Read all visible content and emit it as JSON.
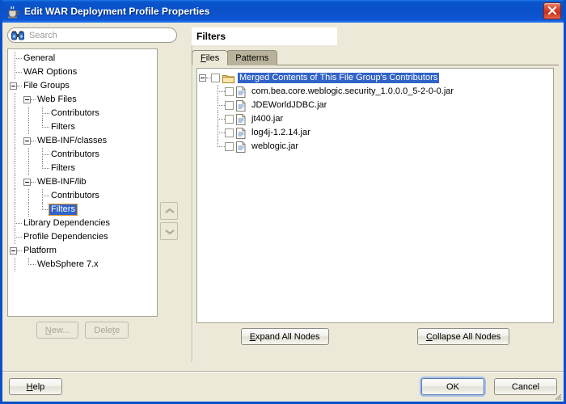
{
  "window": {
    "title": "Edit WAR Deployment Profile Properties",
    "icon": "java-coffee-cup-icon",
    "close_label": "Close",
    "frame_color": "#0a50c8"
  },
  "search": {
    "placeholder": "Search",
    "value": "",
    "icon": "binoculars-icon"
  },
  "nav_tree": {
    "nodes": [
      {
        "label": "General",
        "depth": 0,
        "toggle": "none",
        "guide": "tee",
        "selected": false
      },
      {
        "label": "WAR Options",
        "depth": 0,
        "toggle": "none",
        "guide": "tee",
        "selected": false
      },
      {
        "label": "File Groups",
        "depth": 0,
        "toggle": "expanded",
        "guide": "none",
        "selected": false
      },
      {
        "label": "Web Files",
        "depth": 1,
        "toggle": "expanded",
        "guide": "none",
        "selected": false
      },
      {
        "label": "Contributors",
        "depth": 2,
        "toggle": "none",
        "guide": "tee",
        "selected": false
      },
      {
        "label": "Filters",
        "depth": 2,
        "toggle": "none",
        "guide": "ell",
        "selected": false
      },
      {
        "label": "WEB-INF/classes",
        "depth": 1,
        "toggle": "expanded",
        "guide": "none",
        "selected": false
      },
      {
        "label": "Contributors",
        "depth": 2,
        "toggle": "none",
        "guide": "tee",
        "selected": false
      },
      {
        "label": "Filters",
        "depth": 2,
        "toggle": "none",
        "guide": "ell",
        "selected": false
      },
      {
        "label": "WEB-INF/lib",
        "depth": 1,
        "toggle": "expanded",
        "guide": "none",
        "selected": false
      },
      {
        "label": "Contributors",
        "depth": 2,
        "toggle": "none",
        "guide": "tee",
        "selected": false
      },
      {
        "label": "Filters",
        "depth": 2,
        "toggle": "none",
        "guide": "ell",
        "selected": true
      },
      {
        "label": "Library Dependencies",
        "depth": 0,
        "toggle": "none",
        "guide": "tee",
        "selected": false
      },
      {
        "label": "Profile Dependencies",
        "depth": 0,
        "toggle": "none",
        "guide": "tee",
        "selected": false
      },
      {
        "label": "Platform",
        "depth": 0,
        "toggle": "expanded",
        "guide": "none",
        "selected": false
      },
      {
        "label": "WebSphere 7.x",
        "depth": 1,
        "toggle": "none",
        "guide": "ell",
        "selected": false
      }
    ],
    "selection_bg": "#3163c8",
    "focus_border": "#e09422"
  },
  "side_buttons": [
    {
      "name": "move-up-button",
      "icon": "chevron-up-icon",
      "enabled": false
    },
    {
      "name": "move-down-button",
      "icon": "chevron-down-icon",
      "enabled": false
    }
  ],
  "left_actions": {
    "new_label": "New...",
    "new_mnemonic": "N",
    "new_enabled": false,
    "delete_label": "Delete",
    "delete_mnemonic": "t",
    "delete_enabled": false
  },
  "content": {
    "header_title": "Filters",
    "tabs": [
      {
        "label": "Files",
        "mnemonic": "F",
        "active": true
      },
      {
        "label": "Patterns",
        "mnemonic": "",
        "active": false
      }
    ],
    "file_tree": {
      "root": {
        "label": "Merged Contents of This File Group's Contributors",
        "icon": "folder-icon",
        "checked": false,
        "selected": true,
        "toggle": "expanded"
      },
      "children": [
        {
          "label": "com.bea.core.weblogic.security_1.0.0.0_5-2-0-0.jar",
          "icon": "document-icon",
          "checked": false
        },
        {
          "label": "JDEWorldJDBC.jar",
          "icon": "document-icon",
          "checked": false
        },
        {
          "label": "jt400.jar",
          "icon": "document-icon",
          "checked": false
        },
        {
          "label": "log4j-1.2.14.jar",
          "icon": "document-icon",
          "checked": false
        },
        {
          "label": "weblogic.jar",
          "icon": "document-icon",
          "checked": false
        }
      ]
    },
    "expand_label": "Expand All Nodes",
    "expand_mnemonic": "E",
    "collapse_label": "Collapse All Nodes",
    "collapse_mnemonic": "C"
  },
  "footer": {
    "help_label": "Help",
    "help_mnemonic": "H",
    "ok_label": "OK",
    "ok_focused": true,
    "cancel_label": "Cancel"
  }
}
